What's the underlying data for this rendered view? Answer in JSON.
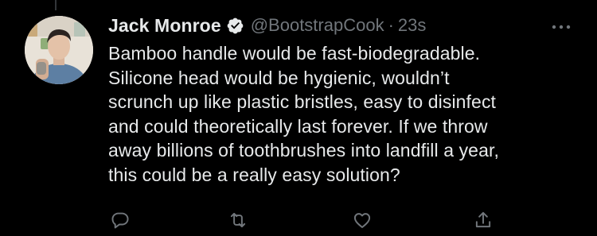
{
  "tweet": {
    "author_name": "Jack Monroe",
    "verified": true,
    "handle": "@BootstrapCook",
    "separator": "·",
    "time": "23s",
    "text": "Bamboo handle would be fast-biodegradable.\nSilicone head would be hygienic, wouldn’t\nscrunch up like plastic bristles, easy to disinfect\nand could theoretically last forever. If we throw\naway billions of toothbrushes into landfill a year,\nthis could be a really easy solution?"
  },
  "icons": {
    "more": "more-horizontal-icon",
    "reply": "reply-icon",
    "retweet": "retweet-icon",
    "like": "heart-icon",
    "share": "share-icon",
    "verified": "verified-badge-icon"
  },
  "colors": {
    "background": "#000000",
    "text": "#e7e9ea",
    "muted": "#71767b",
    "icon": "#71767b",
    "thread_line": "#333639"
  }
}
